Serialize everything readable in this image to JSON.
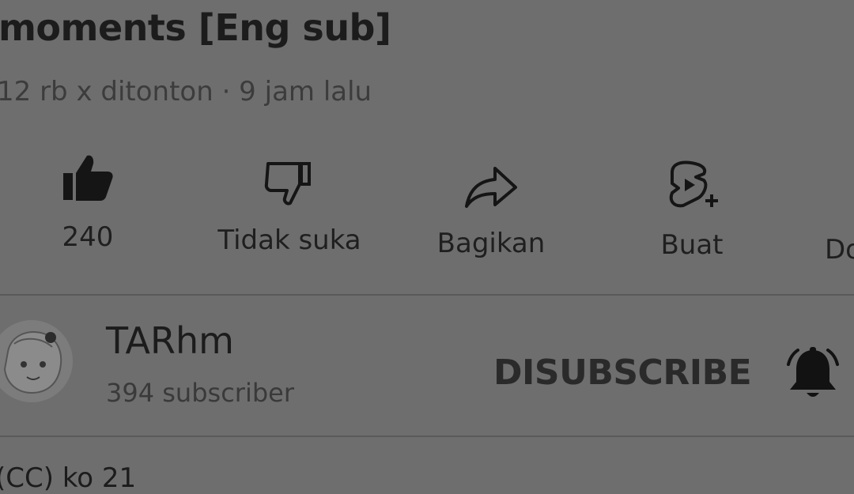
{
  "video": {
    "title": "moments [Eng sub]",
    "meta": "12 rb x ditonton · 9 jam lalu"
  },
  "actions": {
    "like_label": "240",
    "dislike_label": "Tidak suka",
    "share_label": "Bagikan",
    "create_label": "Buat",
    "download_label": "Do"
  },
  "channel": {
    "name": "TARhm",
    "subscribers": "394 subscriber",
    "unsubscribe_label": "DISUBSCRIBE"
  },
  "below": {
    "partial_text": "(CC)   ko 21"
  },
  "icons": {
    "like": "thumbs-up-filled-icon",
    "dislike": "thumbs-down-outline-icon",
    "share": "share-arrow-icon",
    "create": "create-remix-icon",
    "bell": "bell-filled-icon"
  }
}
